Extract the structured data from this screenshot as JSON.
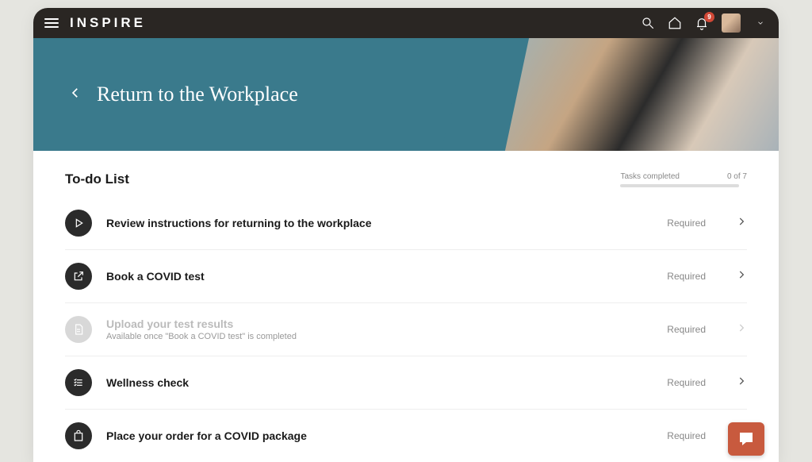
{
  "brand": "INSPIRE",
  "notifications_count": "9",
  "banner": {
    "title": "Return to the Workplace"
  },
  "list": {
    "heading": "To-do List",
    "progress_label": "Tasks completed",
    "progress_value": "0 of 7"
  },
  "items": [
    {
      "title": "Review instructions for returning to the workplace",
      "tag": "Required"
    },
    {
      "title": "Book a COVID test",
      "tag": "Required"
    },
    {
      "title": "Upload your test results",
      "sub": "Available once \"Book a COVID test\" is completed",
      "tag": "Required"
    },
    {
      "title": "Wellness check",
      "tag": "Required"
    },
    {
      "title": "Place your order for a COVID package",
      "tag": "Required"
    }
  ]
}
